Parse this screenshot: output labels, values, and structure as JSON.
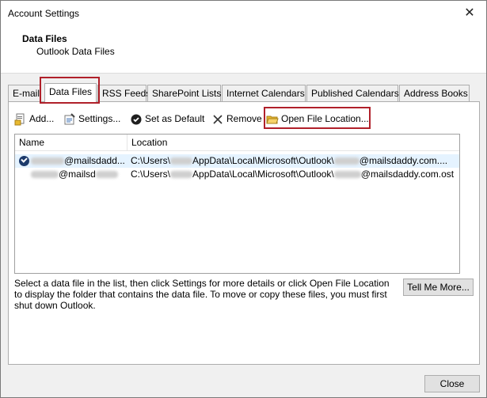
{
  "window": {
    "title": "Account Settings"
  },
  "header": {
    "title": "Data Files",
    "subtitle": "Outlook Data Files"
  },
  "tabs": [
    {
      "label": "E-mail"
    },
    {
      "label": "Data Files",
      "active": true
    },
    {
      "label": "RSS Feeds"
    },
    {
      "label": "SharePoint Lists"
    },
    {
      "label": "Internet Calendars"
    },
    {
      "label": "Published Calendars"
    },
    {
      "label": "Address Books"
    }
  ],
  "toolbar": {
    "add": "Add...",
    "settings": "Settings...",
    "set_default": "Set as Default",
    "remove": "Remove",
    "open_location": "Open File Location..."
  },
  "list": {
    "columns": {
      "name": "Name",
      "location": "Location"
    },
    "rows": [
      {
        "name_visible": "@mailsdadd...",
        "loc_a": "C:\\Users\\",
        "loc_b": "AppData\\Local\\Microsoft\\Outlook\\",
        "loc_c": "@mailsdaddy.com....",
        "default": true
      },
      {
        "name_visible": "@mailsd",
        "loc_a": "C:\\Users\\",
        "loc_b": "AppData\\Local\\Microsoft\\Outlook\\",
        "loc_c": "@mailsdaddy.com.ost",
        "default": false
      }
    ]
  },
  "description": "Select a data file in the list, then click Settings for more details or click Open File Location to display the folder that contains the data file. To move or copy these files, you must first shut down Outlook.",
  "buttons": {
    "tell_me_more": "Tell Me More...",
    "close": "Close"
  },
  "colors": {
    "highlight": "#b0202a",
    "selected_row": "#e5f3ff",
    "folder": "#e8b92f"
  }
}
